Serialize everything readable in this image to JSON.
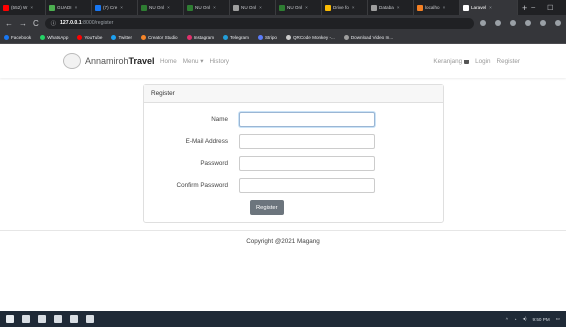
{
  "browser": {
    "tabs": [
      {
        "label": "(552) W",
        "color": "#ff0000"
      },
      {
        "label": "GUADI",
        "color": "#4caf50"
      },
      {
        "label": "(7) Cre",
        "color": "#1877f2"
      },
      {
        "label": "NU Onl",
        "color": "#2e7d32"
      },
      {
        "label": "NU Onl",
        "color": "#2e7d32"
      },
      {
        "label": "NU Onl",
        "color": "#9e9e9e"
      },
      {
        "label": "NU Onl",
        "color": "#2e7d32"
      },
      {
        "label": "Drive fo",
        "color": "#fbbc04"
      },
      {
        "label": "Databa",
        "color": "#9e9e9e"
      },
      {
        "label": "localho",
        "color": "#f48024"
      },
      {
        "label": "Laravel",
        "color": "#ffffff",
        "active": true
      }
    ],
    "new_tab": "+",
    "window_controls": [
      "–",
      "☐",
      "✕"
    ],
    "url_host": "127.0.0.1",
    "url_path": ":8000/register",
    "bookmarks": [
      {
        "label": "Facebook",
        "color": "#1877f2"
      },
      {
        "label": "WhatsApp",
        "color": "#25d366"
      },
      {
        "label": "YouTube",
        "color": "#ff0000"
      },
      {
        "label": "Twitter",
        "color": "#1da1f2"
      },
      {
        "label": "Creator Studio",
        "color": "#f58529"
      },
      {
        "label": "Instagram",
        "color": "#e1306c"
      },
      {
        "label": "Telegram",
        "color": "#229ed9"
      },
      {
        "label": "Stripo",
        "color": "#5b7cfa"
      },
      {
        "label": "QRCode Monkey -...",
        "color": "#cccccc"
      },
      {
        "label": "Download Video In...",
        "color": "#9e9e9e"
      }
    ]
  },
  "navbar": {
    "brand_prefix": "Annamiroh",
    "brand_bold": "Travel",
    "left_links": [
      "Home",
      "Menu ▾",
      "History"
    ],
    "cart_label": "Keranjang",
    "right_links": [
      "Login",
      "Register"
    ]
  },
  "register": {
    "title": "Register",
    "fields": [
      {
        "label": "Name",
        "value": "",
        "focused": true
      },
      {
        "label": "E-Mail Address",
        "value": ""
      },
      {
        "label": "Password",
        "value": ""
      },
      {
        "label": "Confirm Password",
        "value": ""
      }
    ],
    "submit_label": "Register"
  },
  "footer": {
    "copyright": "Copyright @2021 Magang"
  },
  "taskbar": {
    "time": "9:50 PM"
  }
}
